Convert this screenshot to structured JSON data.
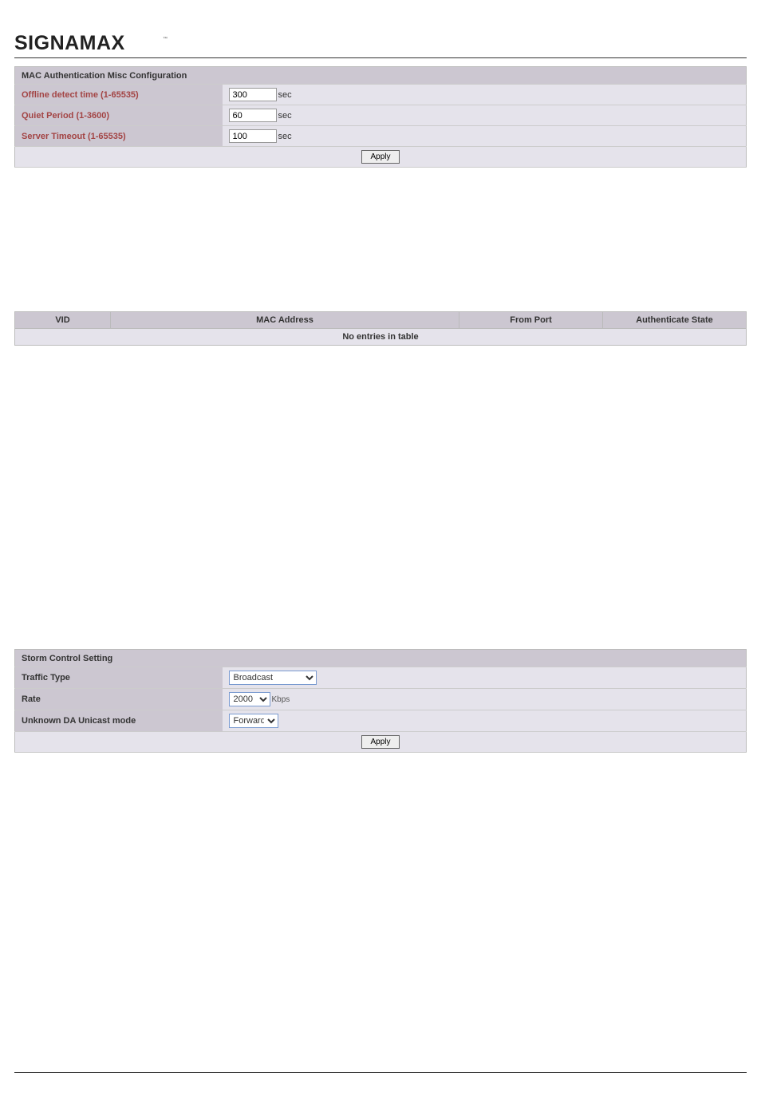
{
  "logo_text": "SIGNAMAX",
  "mac_config": {
    "header": "MAC Authentication Misc Configuration",
    "rows": [
      {
        "label": "Offline detect time (1-65535)",
        "value": "300",
        "unit": "sec"
      },
      {
        "label": "Quiet Period (1-3600)",
        "value": "60",
        "unit": "sec"
      },
      {
        "label": "Server Timeout (1-65535)",
        "value": "100",
        "unit": "sec"
      }
    ],
    "apply_label": "Apply"
  },
  "status": {
    "cols": [
      "VID",
      "MAC Address",
      "From Port",
      "Authenticate State"
    ],
    "no_entries": "No entries in table"
  },
  "storm": {
    "header": "Storm Control Setting",
    "traffic_type_label": "Traffic Type",
    "traffic_type_value": "Broadcast",
    "rate_label": "Rate",
    "rate_value": "2000",
    "rate_unit": "Kbps",
    "unknown_da_label": "Unknown DA Unicast mode",
    "unknown_da_value": "Forward",
    "apply_label": "Apply"
  }
}
